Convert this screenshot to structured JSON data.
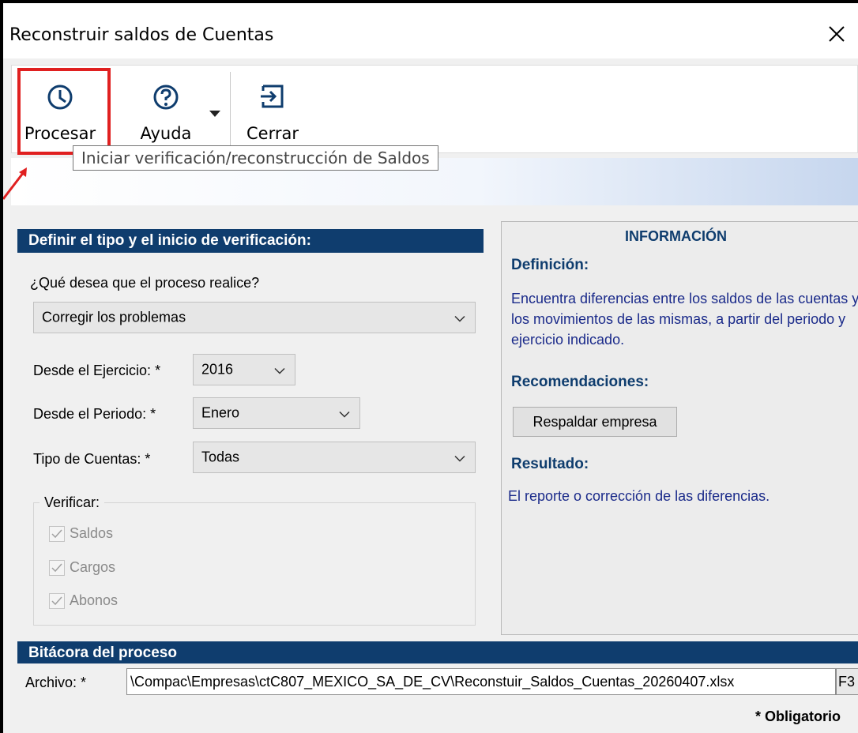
{
  "window": {
    "title": "Reconstruir saldos de Cuentas"
  },
  "toolbar": {
    "procesar_label": "Procesar",
    "ayuda_label": "Ayuda",
    "cerrar_label": "Cerrar",
    "tooltip": "Iniciar verificación/reconstrucción de Saldos"
  },
  "form": {
    "section_title": "Definir el tipo y el inicio de verificación:",
    "question": "¿Qué desea que el proceso realice?",
    "action_value": "Corregir los problemas",
    "ejercicio_label": "Desde el Ejercicio: *",
    "ejercicio_value": "2016",
    "periodo_label": "Desde el Periodo: *",
    "periodo_value": "Enero",
    "tipo_label": "Tipo de Cuentas: *",
    "tipo_value": "Todas",
    "verificar": {
      "legend": "Verificar:",
      "items": [
        {
          "label": "Saldos",
          "checked": true
        },
        {
          "label": "Cargos",
          "checked": true
        },
        {
          "label": "Abonos",
          "checked": true
        }
      ]
    }
  },
  "info": {
    "title": "INFORMACIÓN",
    "definicion_heading": "Definición:",
    "definicion_text": "Encuentra diferencias entre los saldos de las cuentas y los movimientos de las mismas, a partir del periodo y ejercicio indicado.",
    "recomendaciones_heading": "Recomendaciones:",
    "respaldar_label": "Respaldar empresa",
    "resultado_heading": "Resultado:",
    "resultado_text": "El reporte o corrección de las diferencias."
  },
  "bitacora": {
    "section_title": "Bitácora del proceso",
    "archivo_label": "Archivo: *",
    "archivo_value": "\\Compac\\Empresas\\ctC807_MEXICO_SA_DE_CV\\Reconstuir_Saldos_Cuentas_20260407.xlsx",
    "f3_label": "F3"
  },
  "footer": {
    "obligatorio": "* Obligatorio"
  },
  "colors": {
    "header_blue": "#0f3d6e",
    "highlight_red": "#e02020",
    "info_text": "#1a2a8a"
  }
}
